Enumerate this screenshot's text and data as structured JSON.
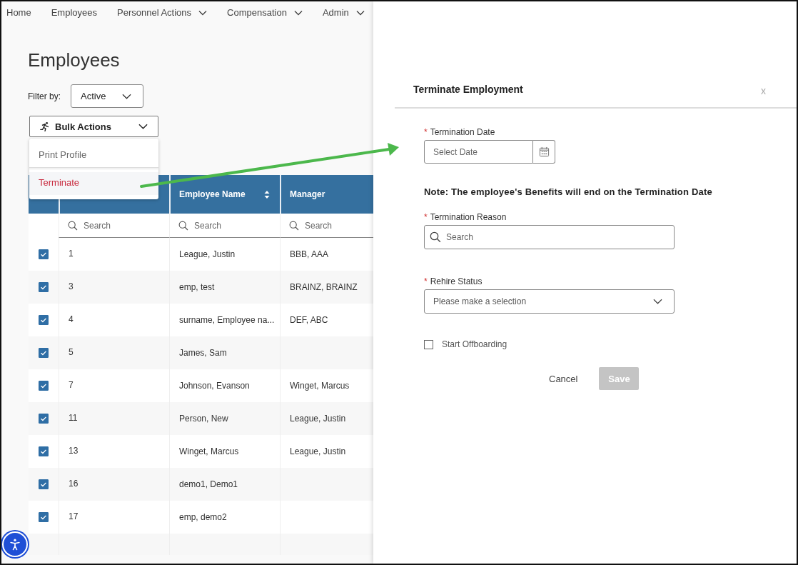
{
  "nav": [
    {
      "label": "Home",
      "dropdown": false
    },
    {
      "label": "Employees",
      "dropdown": false
    },
    {
      "label": "Personnel Actions",
      "dropdown": true
    },
    {
      "label": "Compensation",
      "dropdown": true
    },
    {
      "label": "Admin",
      "dropdown": true
    }
  ],
  "page_title": "Employees",
  "filter": {
    "label": "Filter by:",
    "value": "Active"
  },
  "bulk_actions": {
    "label": "Bulk Actions",
    "menu": [
      {
        "label": "Print Profile",
        "kind": "normal",
        "selected": false
      },
      {
        "label": "Terminate",
        "kind": "danger",
        "selected": true
      }
    ]
  },
  "table": {
    "columns": [
      {
        "kind": "select"
      },
      {
        "kind": "id",
        "search_placeholder": "Search"
      },
      {
        "kind": "text",
        "label": "Employee Name",
        "sortable": true,
        "search_placeholder": "Search"
      },
      {
        "kind": "text",
        "label": "Manager",
        "search_placeholder": "Search"
      }
    ],
    "rows": [
      {
        "checked": true,
        "id": "1",
        "name": "League, Justin",
        "manager": "BBB, AAA"
      },
      {
        "checked": true,
        "id": "3",
        "name": "emp, test",
        "manager": "BRAINZ, BRAINZ"
      },
      {
        "checked": true,
        "id": "4",
        "name": "surname, Employee na...",
        "manager": "DEF, ABC"
      },
      {
        "checked": true,
        "id": "5",
        "name": "James, Sam"
      },
      {
        "checked": true,
        "id": "7",
        "name": "Johnson, Evanson",
        "manager": "Winget, Marcus"
      },
      {
        "checked": true,
        "id": "11",
        "name": "Person, New",
        "manager": "League, Justin"
      },
      {
        "checked": true,
        "id": "13",
        "name": "Winget, Marcus",
        "manager": "League, Justin"
      },
      {
        "checked": true,
        "id": "16",
        "name": "demo1, Demo1"
      },
      {
        "checked": true,
        "id": "17",
        "name": "emp, demo2"
      }
    ]
  },
  "modal": {
    "title": "Terminate Employment",
    "close": "x",
    "fields": [
      {
        "kind": "date",
        "label": "Termination Date",
        "required_mark": "*",
        "placeholder": "Select Date"
      },
      {
        "kind": "note",
        "text": "Note: The employee's Benefits will end on the Termination Date"
      },
      {
        "kind": "search",
        "label": "Termination Reason",
        "required_mark": "*",
        "placeholder": "Search"
      },
      {
        "kind": "select",
        "label": "Rehire Status",
        "required_mark": "*",
        "placeholder": "Please make a selection"
      },
      {
        "kind": "checkbox",
        "label": "Start Offboarding",
        "checked": false
      }
    ],
    "buttons": [
      {
        "label": "Cancel",
        "kind": "text"
      },
      {
        "label": "Save",
        "kind": "primary",
        "disabled": true
      }
    ]
  }
}
